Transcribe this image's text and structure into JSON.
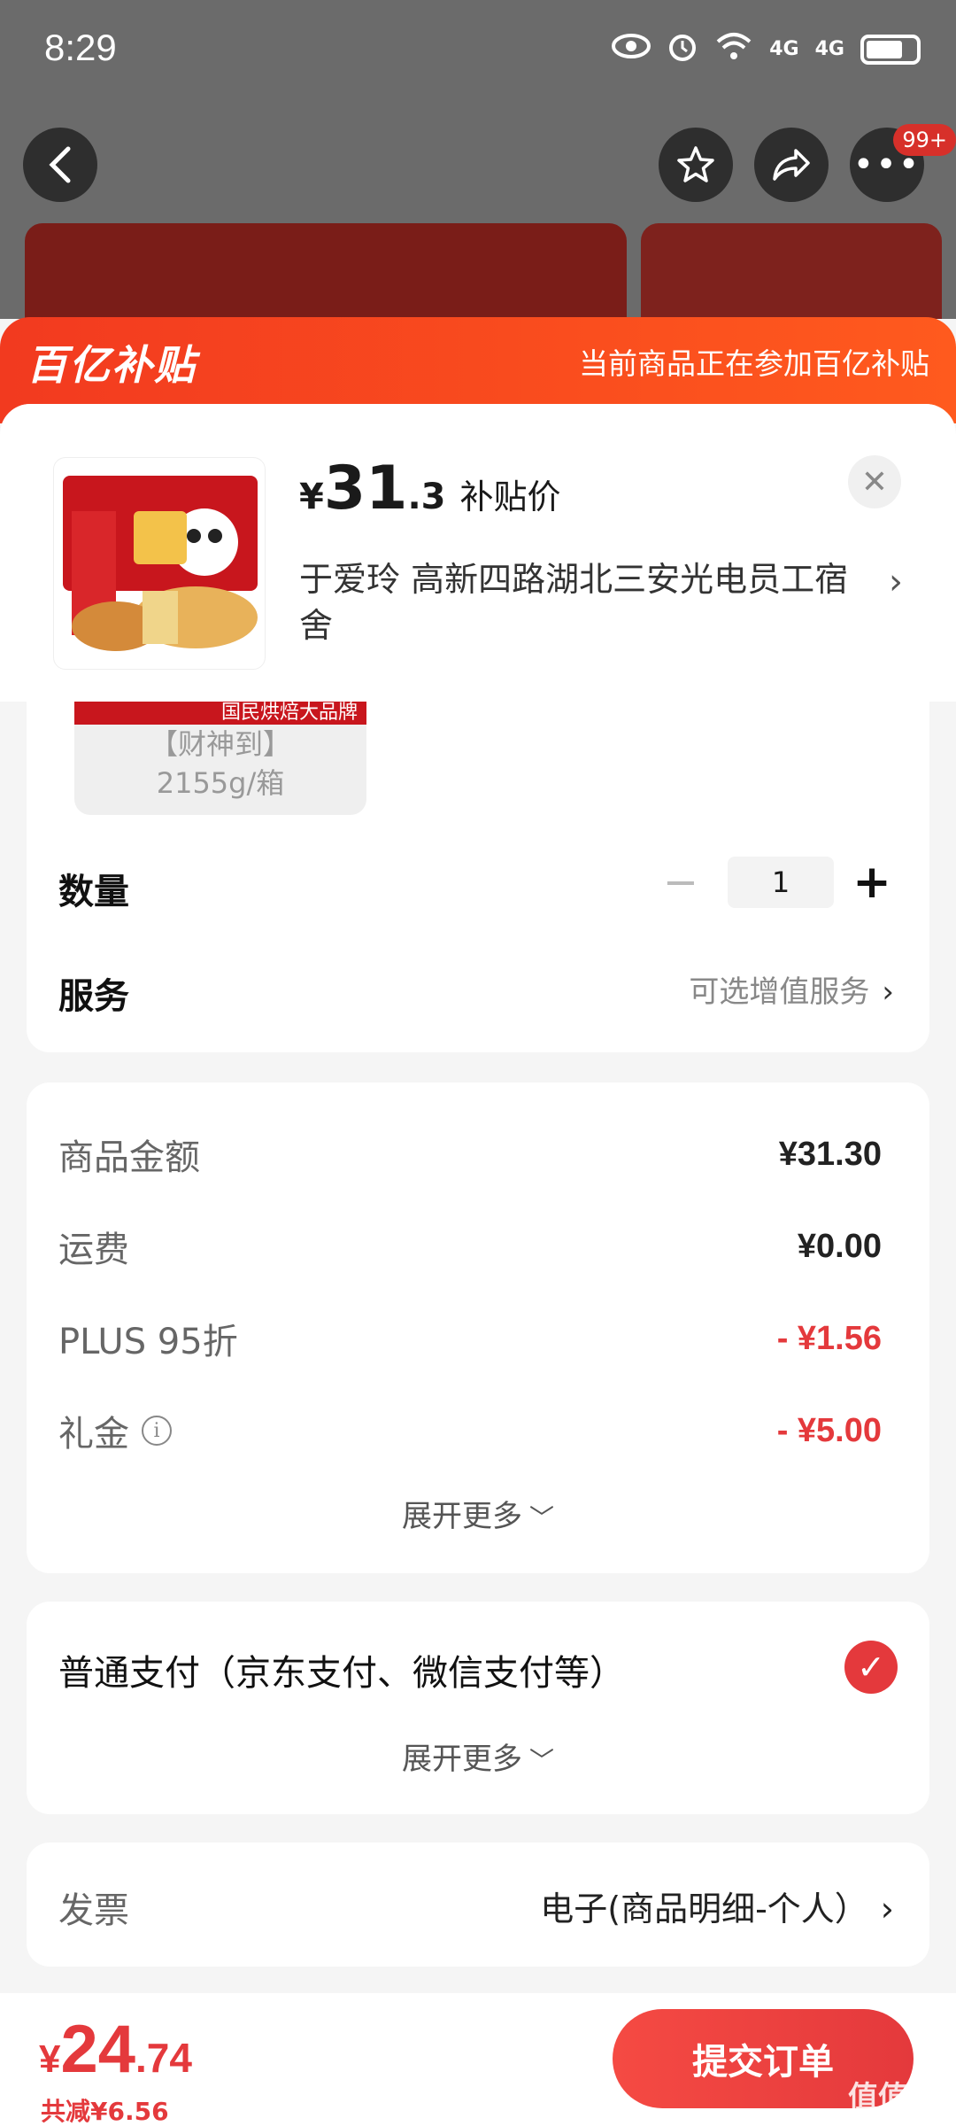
{
  "status_bar": {
    "time": "8:29",
    "network": "4G",
    "network2": "4G"
  },
  "top_nav": {
    "badge": "99+"
  },
  "banner": {
    "logo": "百亿补贴",
    "notice": "当前商品正在参加百亿补贴"
  },
  "product": {
    "price_symbol": "¥",
    "price_int": "31",
    "price_dec": ".3",
    "price_tag": "补贴价",
    "address": "于爱玲  高新四路湖北三安光电员工宿舍"
  },
  "spec": {
    "chip_line1": "【财神到】",
    "chip_line2": "2155g/箱",
    "chip_banner": "国民烘焙大品牌"
  },
  "quantity": {
    "label": "数量",
    "value": "1"
  },
  "service": {
    "label": "服务",
    "value": "可选增值服务"
  },
  "amounts": {
    "rows": [
      {
        "label": "商品金额",
        "value": "¥31.30"
      },
      {
        "label": "运费",
        "value": "¥0.00"
      },
      {
        "label": "PLUS 95折",
        "value": "- ¥1.56"
      },
      {
        "label": "礼金",
        "value": "- ¥5.00"
      }
    ],
    "expand": "展开更多"
  },
  "payment": {
    "label": "普通支付（京东支付、微信支付等）",
    "expand": "展开更多"
  },
  "invoice": {
    "label": "发票",
    "value": "电子(商品明细-个人）"
  },
  "footer": {
    "total_symbol": "¥",
    "total_int": "24",
    "total_dec": ".74",
    "saved": "共减¥6.56",
    "submit": "提交订单",
    "watermark": "值值值"
  },
  "colors": {
    "accent": "#e4393c",
    "banner": "#f23a1f"
  }
}
